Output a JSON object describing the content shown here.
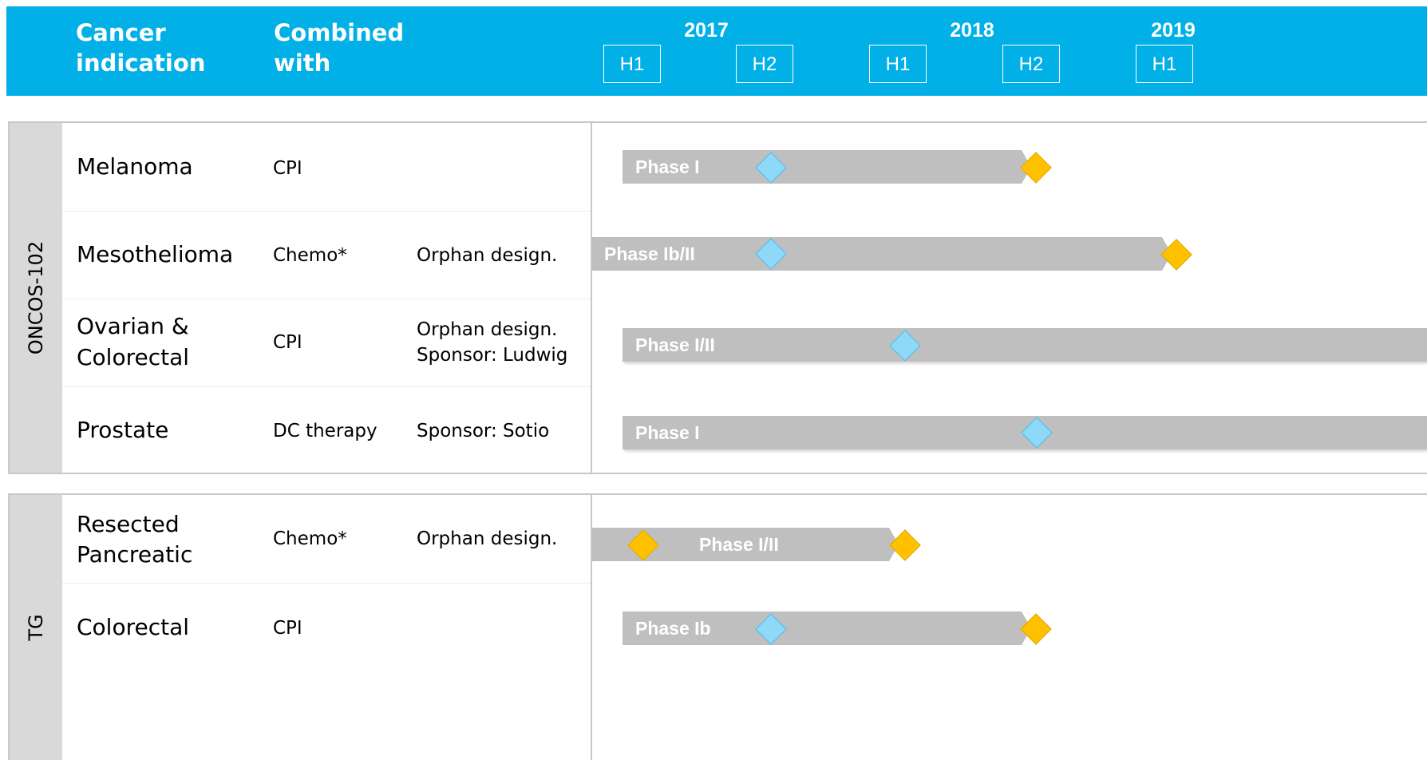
{
  "header": {
    "col_indication": "Cancer indication",
    "col_combined": "Combined with",
    "years": [
      "2017",
      "2018",
      "2019"
    ],
    "halves": [
      "H1",
      "H2",
      "H1",
      "H2",
      "H1"
    ]
  },
  "colors": {
    "header_bg": "#00b0e6",
    "bar": "#bfbfbf",
    "group_label_bg": "#d9d9d9",
    "milestone_blue": "#8ed8f8",
    "milestone_gold": "#ffc000"
  },
  "groups": [
    {
      "name": "ONCOS-102",
      "rows": [
        {
          "indication": "Melanoma",
          "combined": "CPI",
          "note": "",
          "phase": "Phase I",
          "milestones": [
            "blue",
            "gold"
          ]
        },
        {
          "indication": "Mesothelioma",
          "combined": "Chemo*",
          "note": "Orphan design.",
          "phase": "Phase Ib/II",
          "milestones": [
            "blue",
            "gold"
          ]
        },
        {
          "indication": "Ovarian & Colorectal",
          "indication_line1": "Ovarian &",
          "indication_line2": "Colorectal",
          "combined": "CPI",
          "note": "Orphan design. Sponsor: Ludwig",
          "note_line1": "Orphan design.",
          "note_line2": "Sponsor: Ludwig",
          "phase": "Phase I/II",
          "milestones": [
            "blue"
          ]
        },
        {
          "indication": "Prostate",
          "combined": "DC therapy",
          "note": "Sponsor: Sotio",
          "phase": "Phase I",
          "milestones": [
            "blue"
          ]
        }
      ]
    },
    {
      "name": "TG",
      "rows": [
        {
          "indication": "Resected Pancreatic",
          "indication_line1": "Resected",
          "indication_line2": "Pancreatic",
          "combined": "Chemo*",
          "note": "Orphan design.",
          "phase": "Phase I/II",
          "milestones": [
            "gold",
            "gold"
          ]
        },
        {
          "indication": "Colorectal",
          "combined": "CPI",
          "note": "",
          "phase": "Phase Ib",
          "milestones": [
            "blue",
            "gold"
          ]
        }
      ]
    }
  ]
}
